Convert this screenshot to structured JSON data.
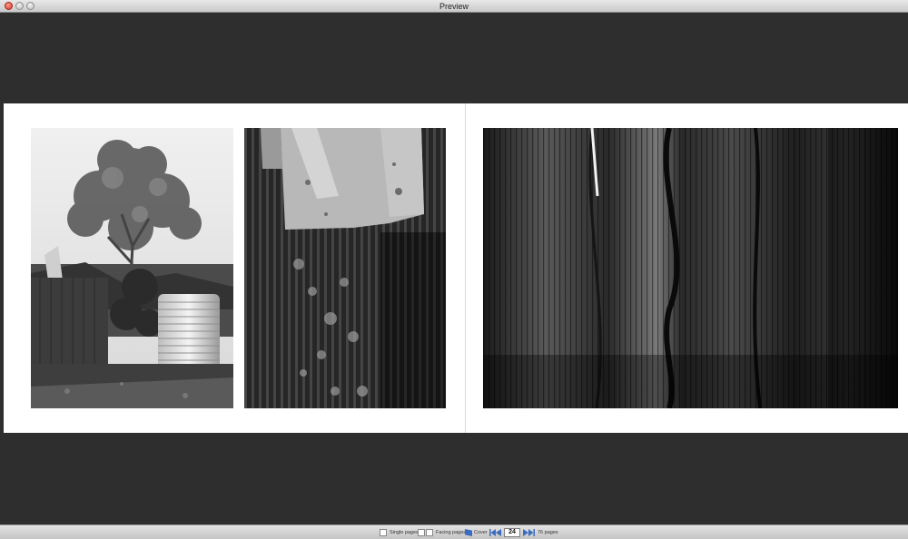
{
  "window": {
    "title": "Preview"
  },
  "book": {
    "photos": [
      {
        "subject": "tree-and-water-tank-photo"
      },
      {
        "subject": "corrugated-iron-wall-photo"
      },
      {
        "subject": "weathered-timber-photo"
      }
    ]
  },
  "statusbar": {
    "single_pages_label": "Single pages",
    "facing_pages_label": "Facing pages",
    "cover_label": "Cover",
    "current_page": "24",
    "total_pages_label": "76 pages"
  },
  "icons": [
    "close-icon",
    "minimize-icon",
    "zoom-icon",
    "cover-icon",
    "first-page-icon",
    "previous-page-icon",
    "next-page-icon",
    "last-page-icon"
  ],
  "colors": {
    "nav_accent": "#3a6cc2",
    "close_button": "#d8342a",
    "viewer_background": "#2e2e2e"
  }
}
